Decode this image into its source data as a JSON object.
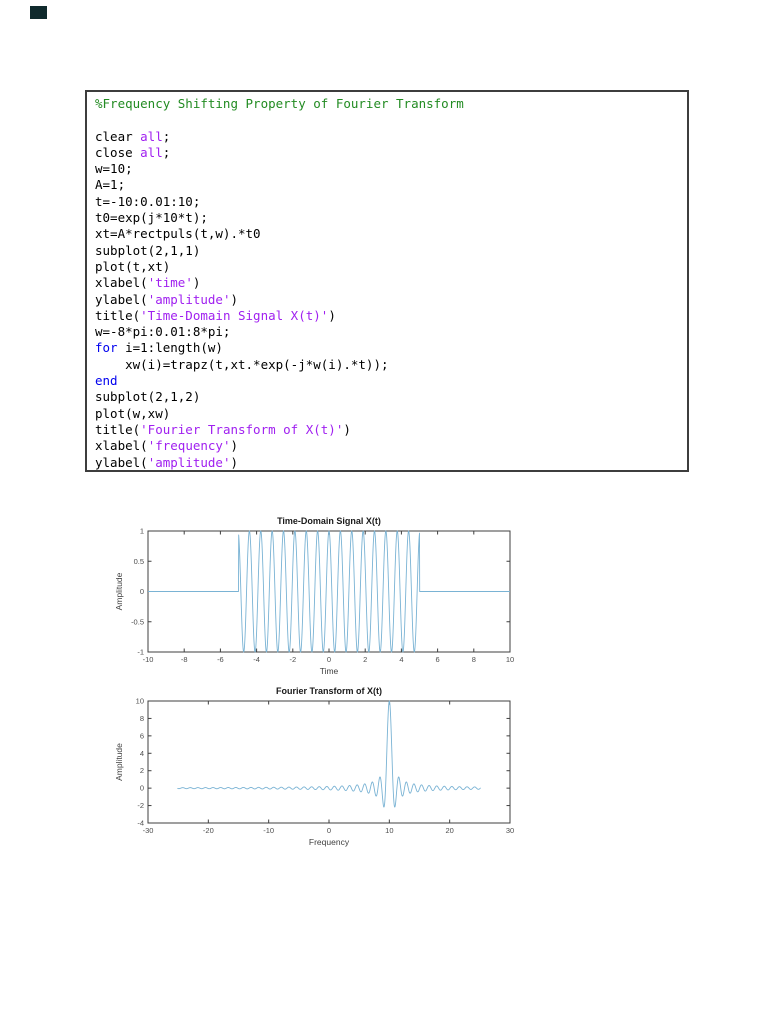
{
  "page": {
    "background": "#ffffff",
    "artifact_color": "#102a2d"
  },
  "code_block": {
    "border_color": "#3d3d3d",
    "syntax_colors": {
      "comment": "#228B22",
      "keyword": "#0000EE",
      "string": "#A020F0",
      "default": "#000000"
    },
    "lines": [
      [
        {
          "t": "%Frequency Shifting Property of Fourier Transform",
          "c": "comment"
        }
      ],
      [],
      [
        {
          "t": "clear ",
          "c": "default"
        },
        {
          "t": "all",
          "c": "string"
        },
        {
          "t": ";",
          "c": "default"
        }
      ],
      [
        {
          "t": "close ",
          "c": "default"
        },
        {
          "t": "all",
          "c": "string"
        },
        {
          "t": ";",
          "c": "default"
        }
      ],
      [
        {
          "t": "w=10;",
          "c": "default"
        }
      ],
      [
        {
          "t": "A=1;",
          "c": "default"
        }
      ],
      [
        {
          "t": "t=-10:0.01:10;",
          "c": "default"
        }
      ],
      [
        {
          "t": "t0=exp(j*10*t);",
          "c": "default"
        }
      ],
      [
        {
          "t": "xt=A*rectpuls(t,w).*t0",
          "c": "default"
        }
      ],
      [
        {
          "t": "subplot(2,1,1)",
          "c": "default"
        }
      ],
      [
        {
          "t": "plot(t,xt)",
          "c": "default"
        }
      ],
      [
        {
          "t": "xlabel(",
          "c": "default"
        },
        {
          "t": "'time'",
          "c": "string"
        },
        {
          "t": ")",
          "c": "default"
        }
      ],
      [
        {
          "t": "ylabel(",
          "c": "default"
        },
        {
          "t": "'amplitude'",
          "c": "string"
        },
        {
          "t": ")",
          "c": "default"
        }
      ],
      [
        {
          "t": "title(",
          "c": "default"
        },
        {
          "t": "'Time-Domain Signal X(t)'",
          "c": "string"
        },
        {
          "t": ")",
          "c": "default"
        }
      ],
      [
        {
          "t": "w=-8*pi:0.01:8*pi;",
          "c": "default"
        }
      ],
      [
        {
          "t": "for",
          "c": "keyword"
        },
        {
          "t": " i=1:length(w)",
          "c": "default"
        }
      ],
      [
        {
          "t": "    xw(i)=trapz(t,xt.*exp(-j*w(i).*t));",
          "c": "default"
        }
      ],
      [
        {
          "t": "end",
          "c": "keyword"
        }
      ],
      [
        {
          "t": "subplot(2,1,2)",
          "c": "default"
        }
      ],
      [
        {
          "t": "plot(w,xw)",
          "c": "default"
        }
      ],
      [
        {
          "t": "title(",
          "c": "default"
        },
        {
          "t": "'Fourier Transform of X(t)'",
          "c": "string"
        },
        {
          "t": ")",
          "c": "default"
        }
      ],
      [
        {
          "t": "xlabel(",
          "c": "default"
        },
        {
          "t": "'frequency'",
          "c": "string"
        },
        {
          "t": ")",
          "c": "default"
        }
      ],
      [
        {
          "t": "ylabel(",
          "c": "default"
        },
        {
          "t": "'amplitude'",
          "c": "string"
        },
        {
          "t": ")",
          "c": "default"
        }
      ]
    ]
  },
  "chart_data": [
    {
      "type": "line",
      "title": "Time-Domain Signal X(t)",
      "xlabel": "Time",
      "ylabel": "Amplitude",
      "xlim": [
        -10,
        10
      ],
      "ylim": [
        -1,
        1
      ],
      "xticks": [
        -10,
        -8,
        -6,
        -4,
        -2,
        0,
        2,
        4,
        6,
        8,
        10
      ],
      "yticks": [
        -1,
        -0.5,
        0,
        0.5,
        1
      ],
      "grid": false,
      "legend": null,
      "line_color": "#7ab3d4",
      "axis_color": "#3f3f3f",
      "series": [
        {
          "name": "xt",
          "description": "cos(10t) for |t|<=5, 0 elsewhere (real part of A*rectpuls(t,10).*exp(j*10*t))",
          "def": {
            "kind": "gated_cosine",
            "amplitude": 1,
            "angular_freq": 10,
            "gate": [
              -5,
              5
            ],
            "x_range": [
              -10,
              10
            ],
            "step": 0.01
          }
        }
      ]
    },
    {
      "type": "line",
      "title": "Fourier Transform of X(t)",
      "xlabel": "Frequency",
      "ylabel": "Amplitude",
      "xlim": [
        -30,
        30
      ],
      "ylim": [
        -4,
        10
      ],
      "xticks": [
        -30,
        -20,
        -10,
        0,
        10,
        20,
        30
      ],
      "yticks": [
        -4,
        -2,
        0,
        2,
        4,
        6,
        8,
        10
      ],
      "grid": false,
      "legend": null,
      "line_color": "#7ab3d4",
      "axis_color": "#3f3f3f",
      "series": [
        {
          "name": "xw",
          "description": "2*sin(5*(w-10))/(w-10); sinc centered at w=10, peak value 10, first sidelobes ~ -2.2",
          "def": {
            "kind": "shifted_sinc",
            "peak": 10,
            "center": 10,
            "gate_halfwidth": 5,
            "x_range": [
              -25.13,
              25.13
            ],
            "step": 0.02
          }
        }
      ]
    }
  ]
}
